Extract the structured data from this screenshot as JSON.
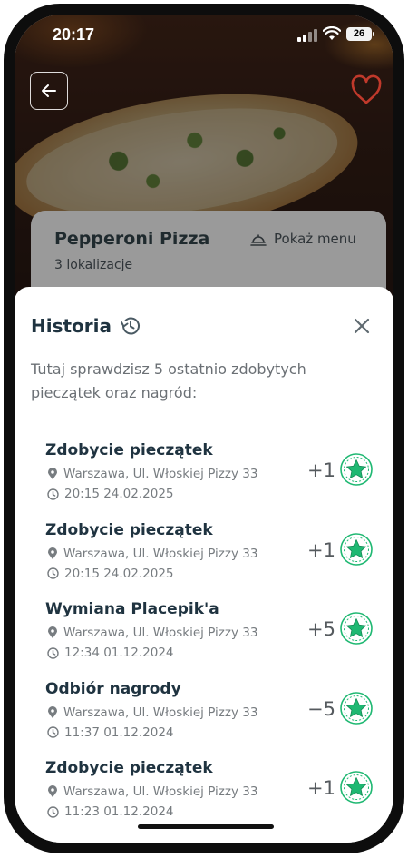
{
  "status_bar": {
    "time": "20:17",
    "battery": "26"
  },
  "restaurant": {
    "name": "Pepperoni Pizza",
    "menu_label": "Pokaż menu",
    "locations": "3 lokalizacje"
  },
  "history": {
    "title": "Historia",
    "description": "Tutaj sprawdzisz 5 ostatnio zdobytych pieczątek oraz nagród:",
    "items": [
      {
        "title": "Zdobycie pieczątek",
        "location": "Warszawa, Ul. Włoskiej Pizzy 33",
        "datetime": "20:15 24.02.2025",
        "points": "+1"
      },
      {
        "title": "Zdobycie pieczątek",
        "location": "Warszawa, Ul. Włoskiej Pizzy 33",
        "datetime": "20:15 24.02.2025",
        "points": "+1"
      },
      {
        "title": "Wymiana Placepik'a",
        "location": "Warszawa, Ul. Włoskiej Pizzy 33",
        "datetime": "12:34 01.12.2024",
        "points": "+5"
      },
      {
        "title": "Odbiór nagrody",
        "location": "Warszawa, Ul. Włoskiej Pizzy 33",
        "datetime": "11:37 01.12.2024",
        "points": "−5"
      },
      {
        "title": "Zdobycie pieczątek",
        "location": "Warszawa, Ul. Włoskiej Pizzy 33",
        "datetime": "11:23 01.12.2024",
        "points": "+1"
      }
    ]
  },
  "colors": {
    "accent_green": "#1fb872",
    "heart_red": "#c0392b",
    "title_text": "#1f3340",
    "muted_text": "#6b7075"
  },
  "icons": {
    "back": "arrow-left-icon",
    "favorite": "heart-icon",
    "menu": "food-menu-icon",
    "history": "history-icon",
    "close": "close-icon",
    "location": "location-pin-icon",
    "time": "clock-icon",
    "stamp": "star-stamp-icon"
  }
}
